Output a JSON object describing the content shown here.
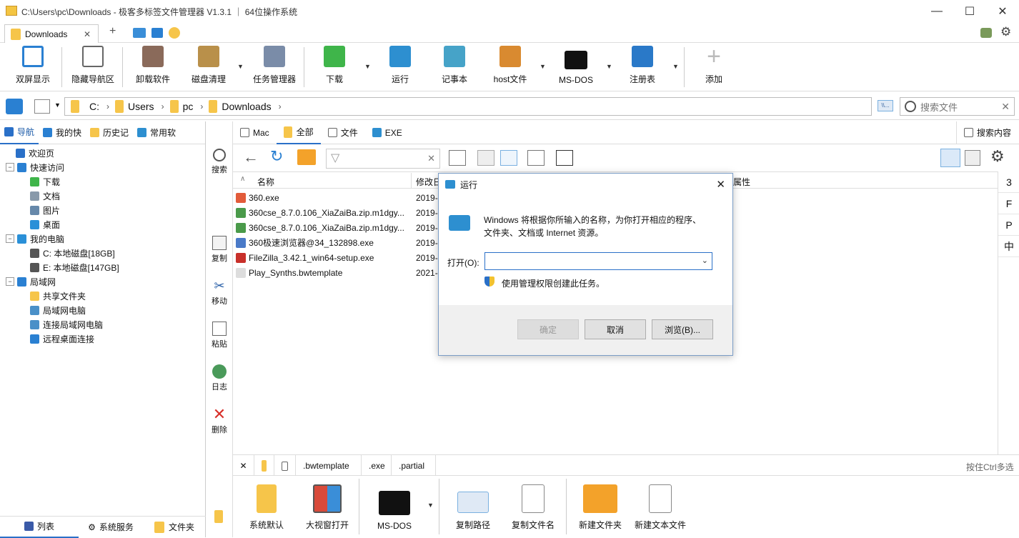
{
  "window": {
    "title": "C:\\Users\\pc\\Downloads - 极客多标签文件管理器 V1.3.1 ｜ 64位操作系统",
    "min": "—",
    "max": "☐",
    "close": "✕"
  },
  "tabs": [
    {
      "label": "Downloads",
      "close": "✕"
    }
  ],
  "tab_add": "+",
  "toolbar": [
    {
      "label": "双屏显示",
      "icon": "dual-screen-icon",
      "color": "#2a80d2"
    },
    {
      "label": "隐藏导航区",
      "icon": "hide-nav-icon",
      "color": "#666666"
    },
    {
      "label": "卸载软件",
      "icon": "uninstall-icon",
      "color": "#8a6a5a"
    },
    {
      "label": "磁盘清理",
      "icon": "disk-clean-icon",
      "color": "#b9904a"
    },
    {
      "label": "任务管理器",
      "icon": "task-manager-icon",
      "color": "#7a8ca8"
    },
    {
      "label": "下载",
      "icon": "download-icon",
      "color": "#3fb54a"
    },
    {
      "label": "运行",
      "icon": "run-icon",
      "color": "#2d8fd0"
    },
    {
      "label": "记事本",
      "icon": "notepad-icon",
      "color": "#46a3c8"
    },
    {
      "label": "host文件",
      "icon": "host-file-icon",
      "color": "#d98a30"
    },
    {
      "label": "MS-DOS",
      "icon": "msdos-icon",
      "color": "#111111"
    },
    {
      "label": "注册表",
      "icon": "registry-icon",
      "color": "#2a79c8"
    },
    {
      "label": "添加",
      "icon": "add-icon",
      "color": "#bbbbbb"
    }
  ],
  "address": {
    "crumbs": [
      "C:",
      "Users",
      "pc",
      "Downloads"
    ],
    "search_placeholder": "搜索文件",
    "path_icon_label": "\\\\..."
  },
  "nav_tabs": [
    "导航",
    "我的快",
    "历史记",
    "常用软"
  ],
  "tree": [
    {
      "label": "欢迎页",
      "level": 1,
      "color": "#2a70c8"
    },
    {
      "label": "快速访问",
      "level": 0,
      "exp": "−",
      "color": "#2a80d2"
    },
    {
      "label": "下载",
      "level": 2,
      "color": "#3fb54a"
    },
    {
      "label": "文档",
      "level": 2,
      "color": "#8899aa"
    },
    {
      "label": "图片",
      "level": 2,
      "color": "#6688aa"
    },
    {
      "label": "桌面",
      "level": 2,
      "color": "#2a90d8"
    },
    {
      "label": "我的电脑",
      "level": 0,
      "exp": "−",
      "color": "#2a90d8"
    },
    {
      "label": "C: 本地磁盘[18GB]",
      "level": 2,
      "color": "#555555"
    },
    {
      "label": "E: 本地磁盘[147GB]",
      "level": 2,
      "color": "#555555"
    },
    {
      "label": "局域网",
      "level": 0,
      "exp": "−",
      "color": "#2a80d2"
    },
    {
      "label": "共享文件夹",
      "level": 2,
      "color": "#f6c54a"
    },
    {
      "label": "局域网电脑",
      "level": 2,
      "color": "#4a90c8"
    },
    {
      "label": "连接局域网电脑",
      "level": 2,
      "color": "#4a90c8"
    },
    {
      "label": "远程桌面连接",
      "level": 2,
      "color": "#2a80d2"
    }
  ],
  "left_bottom": [
    "列表",
    "系统服务",
    "文件夹"
  ],
  "side_actions": [
    "搜索",
    "复制",
    "移动",
    "粘贴",
    "日志",
    "删除"
  ],
  "file_tabs": [
    "Mac",
    "全部",
    "文件",
    "EXE"
  ],
  "search_content": "搜索内容",
  "columns": {
    "name": "名称",
    "date": "修改日",
    "attr": "属性"
  },
  "files": [
    {
      "name": "360.exe",
      "date": "2019-",
      "color": "#e25b3a"
    },
    {
      "name": "360cse_8.7.0.106_XiaZaiBa.zip.m1dgy...",
      "date": "2019-",
      "color": "#4a9a4a"
    },
    {
      "name": "360cse_8.7.0.106_XiaZaiBa.zip.m1dgy...",
      "date": "2019-",
      "color": "#4a9a4a"
    },
    {
      "name": "360极速浏览器@34_132898.exe",
      "date": "2019-",
      "color": "#4a7ac8"
    },
    {
      "name": "FileZilla_3.42.1_win64-setup.exe",
      "date": "2019-",
      "color": "#c8302a"
    },
    {
      "name": "Play_Synths.bwtemplate",
      "date": "2021-",
      "color": "#dddddd"
    }
  ],
  "right_strip": [
    "3",
    "F",
    "P",
    "中"
  ],
  "filters": [
    ".bwtemplate",
    ".exe",
    ".partial"
  ],
  "filter_hint": "按住Ctrl多选",
  "bottom_tools": [
    {
      "label": "系统默认",
      "icon": "system-default-icon",
      "color": "#f6c54a"
    },
    {
      "label": "大视窗打开",
      "icon": "big-window-icon",
      "color": "#d84a3a"
    },
    {
      "label": "MS-DOS",
      "icon": "msdos-icon",
      "color": "#111111"
    },
    {
      "label": "复制路径",
      "icon": "copy-path-icon",
      "color": "#7ab0e0"
    },
    {
      "label": "复制文件名",
      "icon": "copy-filename-icon",
      "color": "#eeeeee"
    },
    {
      "label": "新建文件夹",
      "icon": "new-folder-icon",
      "color": "#f3a22a"
    },
    {
      "label": "新建文本文件",
      "icon": "new-text-file-icon",
      "color": "#eeeeee"
    }
  ],
  "dialog": {
    "title": "运行",
    "desc1": "Windows 将根据你所输入的名称，为你打开相应的程序、",
    "desc2": "文件夹、文档或 Internet 资源。",
    "open_label": "打开(O):",
    "open_value": "",
    "admin": "使用管理权限创建此任务。",
    "ok": "确定",
    "cancel": "取消",
    "browse": "浏览(B)..."
  }
}
